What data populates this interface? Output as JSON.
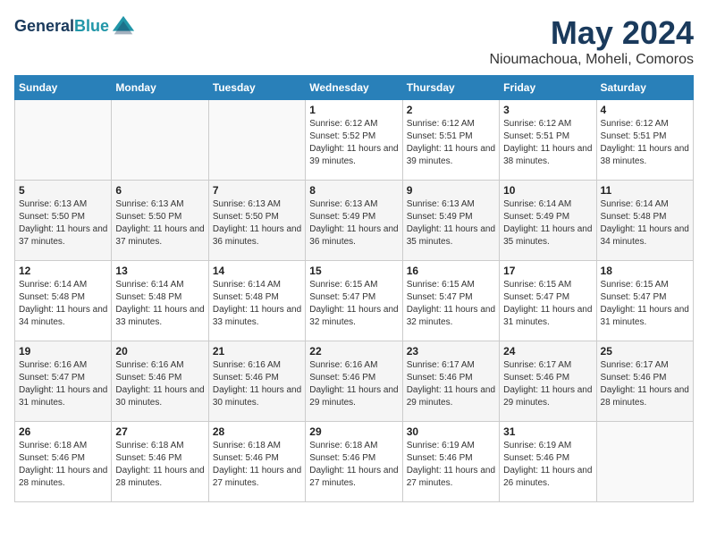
{
  "header": {
    "logo_line1": "General",
    "logo_line2": "Blue",
    "month_title": "May 2024",
    "location": "Nioumachoua, Moheli, Comoros"
  },
  "days_of_week": [
    "Sunday",
    "Monday",
    "Tuesday",
    "Wednesday",
    "Thursday",
    "Friday",
    "Saturday"
  ],
  "weeks": [
    [
      {
        "day": null
      },
      {
        "day": null
      },
      {
        "day": null
      },
      {
        "day": 1,
        "sunrise": "6:12 AM",
        "sunset": "5:52 PM",
        "daylight": "11 hours and 39 minutes."
      },
      {
        "day": 2,
        "sunrise": "6:12 AM",
        "sunset": "5:51 PM",
        "daylight": "11 hours and 39 minutes."
      },
      {
        "day": 3,
        "sunrise": "6:12 AM",
        "sunset": "5:51 PM",
        "daylight": "11 hours and 38 minutes."
      },
      {
        "day": 4,
        "sunrise": "6:12 AM",
        "sunset": "5:51 PM",
        "daylight": "11 hours and 38 minutes."
      }
    ],
    [
      {
        "day": 5,
        "sunrise": "6:13 AM",
        "sunset": "5:50 PM",
        "daylight": "11 hours and 37 minutes."
      },
      {
        "day": 6,
        "sunrise": "6:13 AM",
        "sunset": "5:50 PM",
        "daylight": "11 hours and 37 minutes."
      },
      {
        "day": 7,
        "sunrise": "6:13 AM",
        "sunset": "5:50 PM",
        "daylight": "11 hours and 36 minutes."
      },
      {
        "day": 8,
        "sunrise": "6:13 AM",
        "sunset": "5:49 PM",
        "daylight": "11 hours and 36 minutes."
      },
      {
        "day": 9,
        "sunrise": "6:13 AM",
        "sunset": "5:49 PM",
        "daylight": "11 hours and 35 minutes."
      },
      {
        "day": 10,
        "sunrise": "6:14 AM",
        "sunset": "5:49 PM",
        "daylight": "11 hours and 35 minutes."
      },
      {
        "day": 11,
        "sunrise": "6:14 AM",
        "sunset": "5:48 PM",
        "daylight": "11 hours and 34 minutes."
      }
    ],
    [
      {
        "day": 12,
        "sunrise": "6:14 AM",
        "sunset": "5:48 PM",
        "daylight": "11 hours and 34 minutes."
      },
      {
        "day": 13,
        "sunrise": "6:14 AM",
        "sunset": "5:48 PM",
        "daylight": "11 hours and 33 minutes."
      },
      {
        "day": 14,
        "sunrise": "6:14 AM",
        "sunset": "5:48 PM",
        "daylight": "11 hours and 33 minutes."
      },
      {
        "day": 15,
        "sunrise": "6:15 AM",
        "sunset": "5:47 PM",
        "daylight": "11 hours and 32 minutes."
      },
      {
        "day": 16,
        "sunrise": "6:15 AM",
        "sunset": "5:47 PM",
        "daylight": "11 hours and 32 minutes."
      },
      {
        "day": 17,
        "sunrise": "6:15 AM",
        "sunset": "5:47 PM",
        "daylight": "11 hours and 31 minutes."
      },
      {
        "day": 18,
        "sunrise": "6:15 AM",
        "sunset": "5:47 PM",
        "daylight": "11 hours and 31 minutes."
      }
    ],
    [
      {
        "day": 19,
        "sunrise": "6:16 AM",
        "sunset": "5:47 PM",
        "daylight": "11 hours and 31 minutes."
      },
      {
        "day": 20,
        "sunrise": "6:16 AM",
        "sunset": "5:46 PM",
        "daylight": "11 hours and 30 minutes."
      },
      {
        "day": 21,
        "sunrise": "6:16 AM",
        "sunset": "5:46 PM",
        "daylight": "11 hours and 30 minutes."
      },
      {
        "day": 22,
        "sunrise": "6:16 AM",
        "sunset": "5:46 PM",
        "daylight": "11 hours and 29 minutes."
      },
      {
        "day": 23,
        "sunrise": "6:17 AM",
        "sunset": "5:46 PM",
        "daylight": "11 hours and 29 minutes."
      },
      {
        "day": 24,
        "sunrise": "6:17 AM",
        "sunset": "5:46 PM",
        "daylight": "11 hours and 29 minutes."
      },
      {
        "day": 25,
        "sunrise": "6:17 AM",
        "sunset": "5:46 PM",
        "daylight": "11 hours and 28 minutes."
      }
    ],
    [
      {
        "day": 26,
        "sunrise": "6:18 AM",
        "sunset": "5:46 PM",
        "daylight": "11 hours and 28 minutes."
      },
      {
        "day": 27,
        "sunrise": "6:18 AM",
        "sunset": "5:46 PM",
        "daylight": "11 hours and 28 minutes."
      },
      {
        "day": 28,
        "sunrise": "6:18 AM",
        "sunset": "5:46 PM",
        "daylight": "11 hours and 27 minutes."
      },
      {
        "day": 29,
        "sunrise": "6:18 AM",
        "sunset": "5:46 PM",
        "daylight": "11 hours and 27 minutes."
      },
      {
        "day": 30,
        "sunrise": "6:19 AM",
        "sunset": "5:46 PM",
        "daylight": "11 hours and 27 minutes."
      },
      {
        "day": 31,
        "sunrise": "6:19 AM",
        "sunset": "5:46 PM",
        "daylight": "11 hours and 26 minutes."
      },
      {
        "day": null
      }
    ]
  ]
}
